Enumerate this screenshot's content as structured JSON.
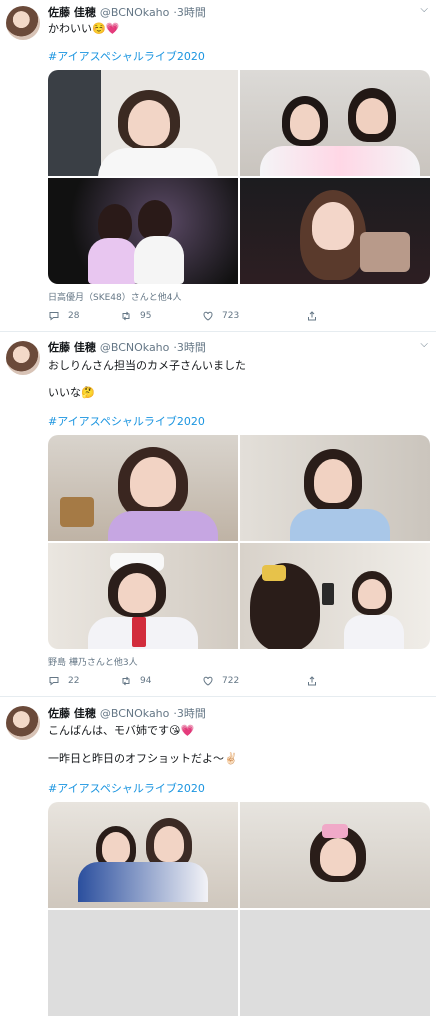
{
  "tweets": [
    {
      "author": "佐藤 佳穂",
      "handle": "@BCNOkaho",
      "time": "3時間",
      "lines": [
        "かわいい☺️💗"
      ],
      "hashtag": "#アイアスペシャルライブ2020",
      "caption": "日高優月（SKE48）さんと他4人",
      "replies": "28",
      "retweets": "95",
      "likes": "723"
    },
    {
      "author": "佐藤 佳穂",
      "handle": "@BCNOkaho",
      "time": "3時間",
      "lines": [
        "おしりんさん担当のカメ子さんいました",
        "いいな🤔"
      ],
      "hashtag": "#アイアスペシャルライブ2020",
      "caption": "野島 樺乃さんと他3人",
      "replies": "22",
      "retweets": "94",
      "likes": "722"
    },
    {
      "author": "佐藤 佳穂",
      "handle": "@BCNOkaho",
      "time": "3時間",
      "lines": [
        "こんばんは、モバ姉です😘💗",
        "一昨日と昨日のオフショットだよ〜✌🏻"
      ],
      "hashtag": "#アイアスペシャルライブ2020"
    }
  ],
  "icons": [
    "reply-icon",
    "retweet-icon",
    "like-icon",
    "share-icon",
    "chevron-down-icon"
  ],
  "colors": {
    "link": "#1b95e0",
    "muted": "#657786",
    "text": "#14171a",
    "divider": "#e6ecf0"
  }
}
